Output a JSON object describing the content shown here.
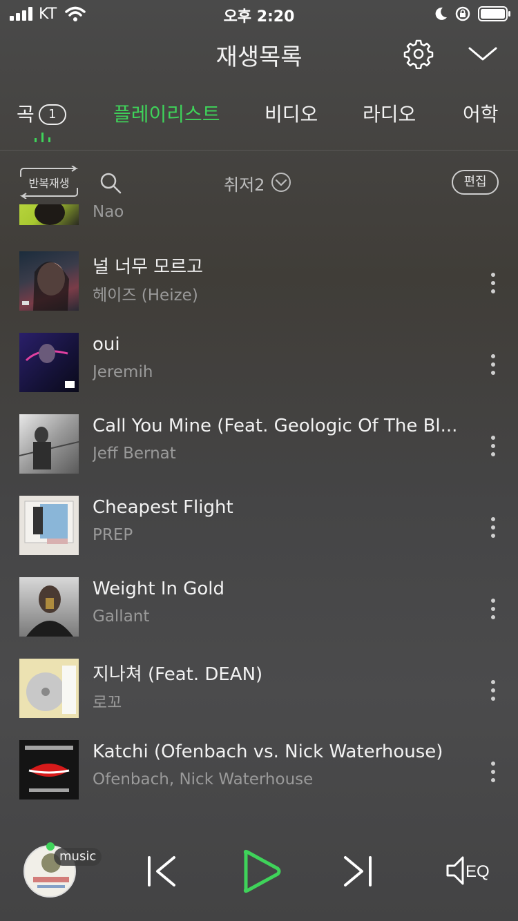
{
  "status": {
    "carrier": "KT",
    "time": "오후 2:20"
  },
  "header": {
    "title": "재생목록"
  },
  "tabs": {
    "song": {
      "label": "곡",
      "badge": "1"
    },
    "playlist": "플레이리스트",
    "video": "비디오",
    "radio": "라디오",
    "lang": "어학"
  },
  "toolbar": {
    "repeat_label": "반복재생",
    "playlist_name": "취저2",
    "edit_label": "편집"
  },
  "songs": [
    {
      "title": "",
      "artist": "Nao"
    },
    {
      "title": "널 너무 모르고",
      "artist": "헤이즈 (Heize)"
    },
    {
      "title": "oui",
      "artist": "Jeremih"
    },
    {
      "title": "Call You Mine (Feat. Geologic Of The Bl...",
      "artist": "Jeff Bernat"
    },
    {
      "title": "Cheapest Flight",
      "artist": "PREP"
    },
    {
      "title": "Weight In Gold",
      "artist": "Gallant"
    },
    {
      "title": "지나쳐 (Feat. DEAN)",
      "artist": "로꼬"
    },
    {
      "title": "Katchi (Ofenbach vs. Nick Waterhouse)",
      "artist": "Ofenbach, Nick Waterhouse"
    }
  ],
  "player": {
    "badge": "music"
  },
  "colors": {
    "accent": "#3fd35a"
  },
  "icons": [
    "signal-icon",
    "wifi-icon",
    "moon-icon",
    "rotation-lock-icon",
    "battery-icon",
    "gear-icon",
    "chevron-down-icon",
    "search-icon",
    "repeat-icon",
    "more-icon",
    "previous-icon",
    "play-icon",
    "next-icon",
    "eq-icon"
  ]
}
